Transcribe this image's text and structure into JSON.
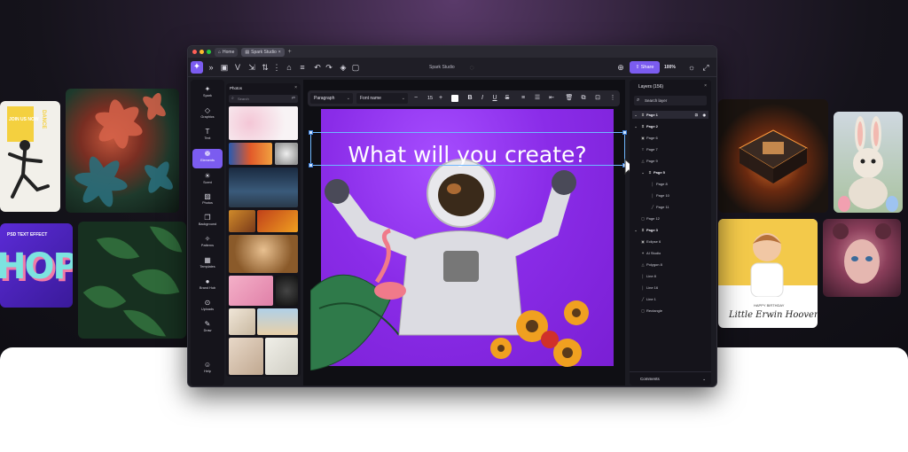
{
  "window": {
    "tabs": [
      {
        "label": "Home",
        "icon": "home-icon"
      },
      {
        "label": "Spark Studio",
        "icon": "file-icon"
      }
    ],
    "doc_title": "Spark Studio",
    "share_label": "Share",
    "zoom": "100%"
  },
  "rail": {
    "items": [
      {
        "label": "Spark",
        "icon": "sparkle-icon"
      },
      {
        "label": "Graphics",
        "icon": "graphics-icon"
      },
      {
        "label": "Text",
        "icon": "text-icon"
      },
      {
        "label": "Elements",
        "icon": "elements-icon"
      },
      {
        "label": "Scent",
        "icon": "sun-icon"
      },
      {
        "label": "Photos",
        "icon": "photo-icon"
      },
      {
        "label": "Background",
        "icon": "background-icon"
      },
      {
        "label": "Patterns",
        "icon": "pattern-icon"
      },
      {
        "label": "Templates",
        "icon": "template-icon"
      },
      {
        "label": "Brand Hub",
        "icon": "brand-icon"
      },
      {
        "label": "Uploads",
        "icon": "upload-icon"
      },
      {
        "label": "Draw",
        "icon": "pen-icon"
      },
      {
        "label": "Help",
        "icon": "help-icon"
      }
    ],
    "active_index": 3
  },
  "photos": {
    "title": "Photos",
    "search_placeholder": "Search"
  },
  "format_bar": {
    "style_select": "Paragraph",
    "font_select": "Font name",
    "font_size": "15"
  },
  "canvas": {
    "headline": "What will you create?"
  },
  "layers": {
    "title": "Layers (156)",
    "search_placeholder": "Search layer",
    "rows": [
      {
        "label": "Page 1",
        "bold": true,
        "selected": true
      },
      {
        "label": "Page 2",
        "bold": true
      },
      {
        "label": "Page 6"
      },
      {
        "label": "Page 7"
      },
      {
        "label": "Page 9"
      },
      {
        "label": "Page 5",
        "bold": true
      },
      {
        "label": "Page 8"
      },
      {
        "label": "Page 10"
      },
      {
        "label": "Page 11"
      },
      {
        "label": "Page 12"
      },
      {
        "label": "Page 3",
        "bold": true
      },
      {
        "label": "Eclipse 6"
      },
      {
        "label": "AI Studio"
      },
      {
        "label": "Polygon 8"
      },
      {
        "label": "Line 8"
      },
      {
        "label": "Line 16"
      },
      {
        "label": "Line 1"
      },
      {
        "label": "Rectangle"
      }
    ],
    "comments_label": "Comments"
  },
  "tiles": {
    "dance_text": "JOIN US NOW",
    "dance_side": "DANCE",
    "psd_text": "PSD TEXT EFFECT",
    "hope_text": "HOPE",
    "birthday_small": "HAPPY BIRTHDAY",
    "birthday_name": "Little Erwin Hoover"
  },
  "colors": {
    "accent": "#7b5cf0",
    "canvas_purple": "#8a2ce8"
  }
}
